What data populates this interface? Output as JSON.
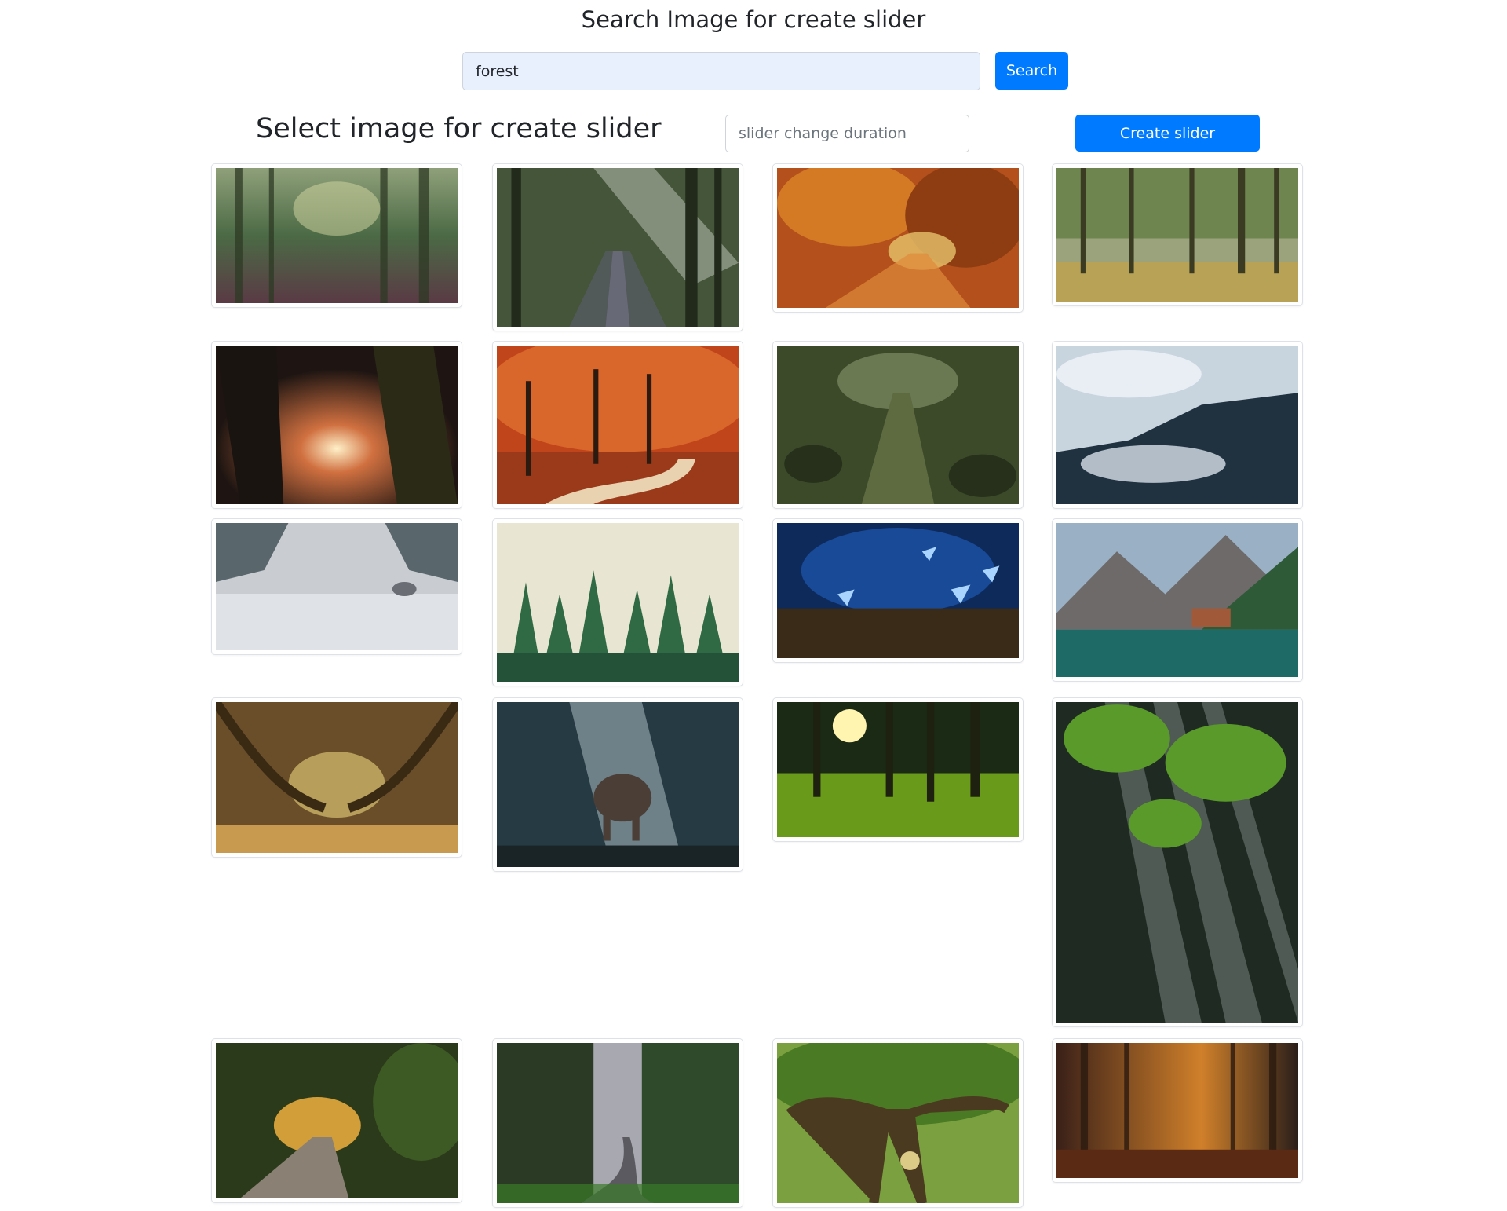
{
  "header": {
    "title": "Search Image for create slider"
  },
  "search": {
    "value": "forest",
    "button_label": "Search"
  },
  "slider_form": {
    "heading": "Select image for create slider",
    "duration_placeholder": "slider change duration",
    "create_label": "Create slider"
  },
  "colors": {
    "primary": "#007bff",
    "search_field_bg": "#e8f0fe"
  },
  "images": [
    {
      "subject": "misty-forest"
    },
    {
      "subject": "forest-path-sunbeams"
    },
    {
      "subject": "autumn-forest-path"
    },
    {
      "subject": "green-forest-meadow"
    },
    {
      "subject": "dark-forest-glow"
    },
    {
      "subject": "red-autumn-road"
    },
    {
      "subject": "mossy-forest-trail"
    },
    {
      "subject": "foggy-mountain-forest"
    },
    {
      "subject": "wolf-in-fog"
    },
    {
      "subject": "misty-pine-forest"
    },
    {
      "subject": "blue-butterflies-mushrooms"
    },
    {
      "subject": "mountain-lake-boathouse"
    },
    {
      "subject": "tree-tunnel-road"
    },
    {
      "subject": "elephant-in-forest"
    },
    {
      "subject": "sunlit-forest-grass"
    },
    {
      "subject": "sun-rays-through-leaves"
    },
    {
      "subject": "sunny-forest-road"
    },
    {
      "subject": "redwood-road"
    },
    {
      "subject": "giant-old-tree"
    },
    {
      "subject": "orange-misty-forest"
    }
  ]
}
